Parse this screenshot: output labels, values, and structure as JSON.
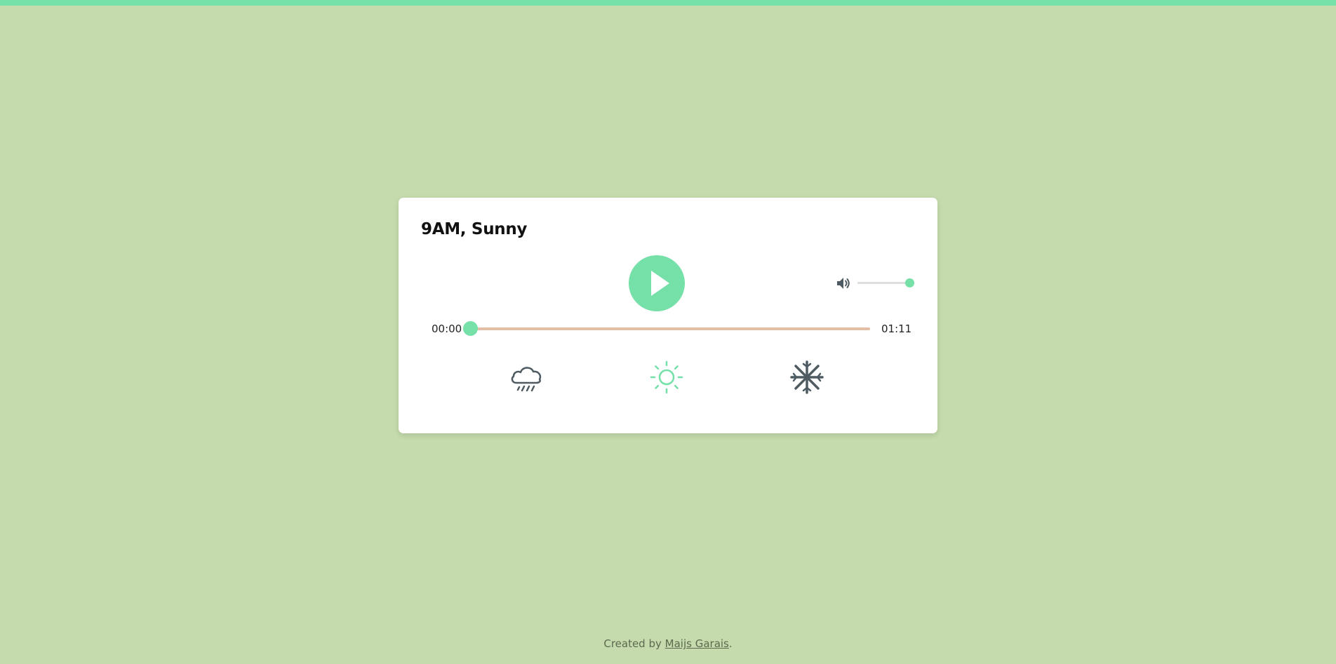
{
  "player": {
    "title": "9AM, Sunny",
    "current_time": "00:00",
    "total_time": "01:11",
    "progress": 0.0,
    "volume": 1.0,
    "play_icon": "play-icon",
    "volume_icon": "volume-icon"
  },
  "weather_options": [
    {
      "name": "rain",
      "icon": "cloud-rain-icon",
      "active": false
    },
    {
      "name": "sunny",
      "icon": "sun-icon",
      "active": true
    },
    {
      "name": "snow",
      "icon": "snowflake-icon",
      "active": false
    }
  ],
  "footer": {
    "prefix": "Created by",
    "author": "Maijs Garais",
    "suffix": "."
  },
  "colors": {
    "background": "#c5dbad",
    "accent": "#75e0a8",
    "progress_track": "#e3bfa6",
    "icon_inactive": "#4f5b62"
  }
}
